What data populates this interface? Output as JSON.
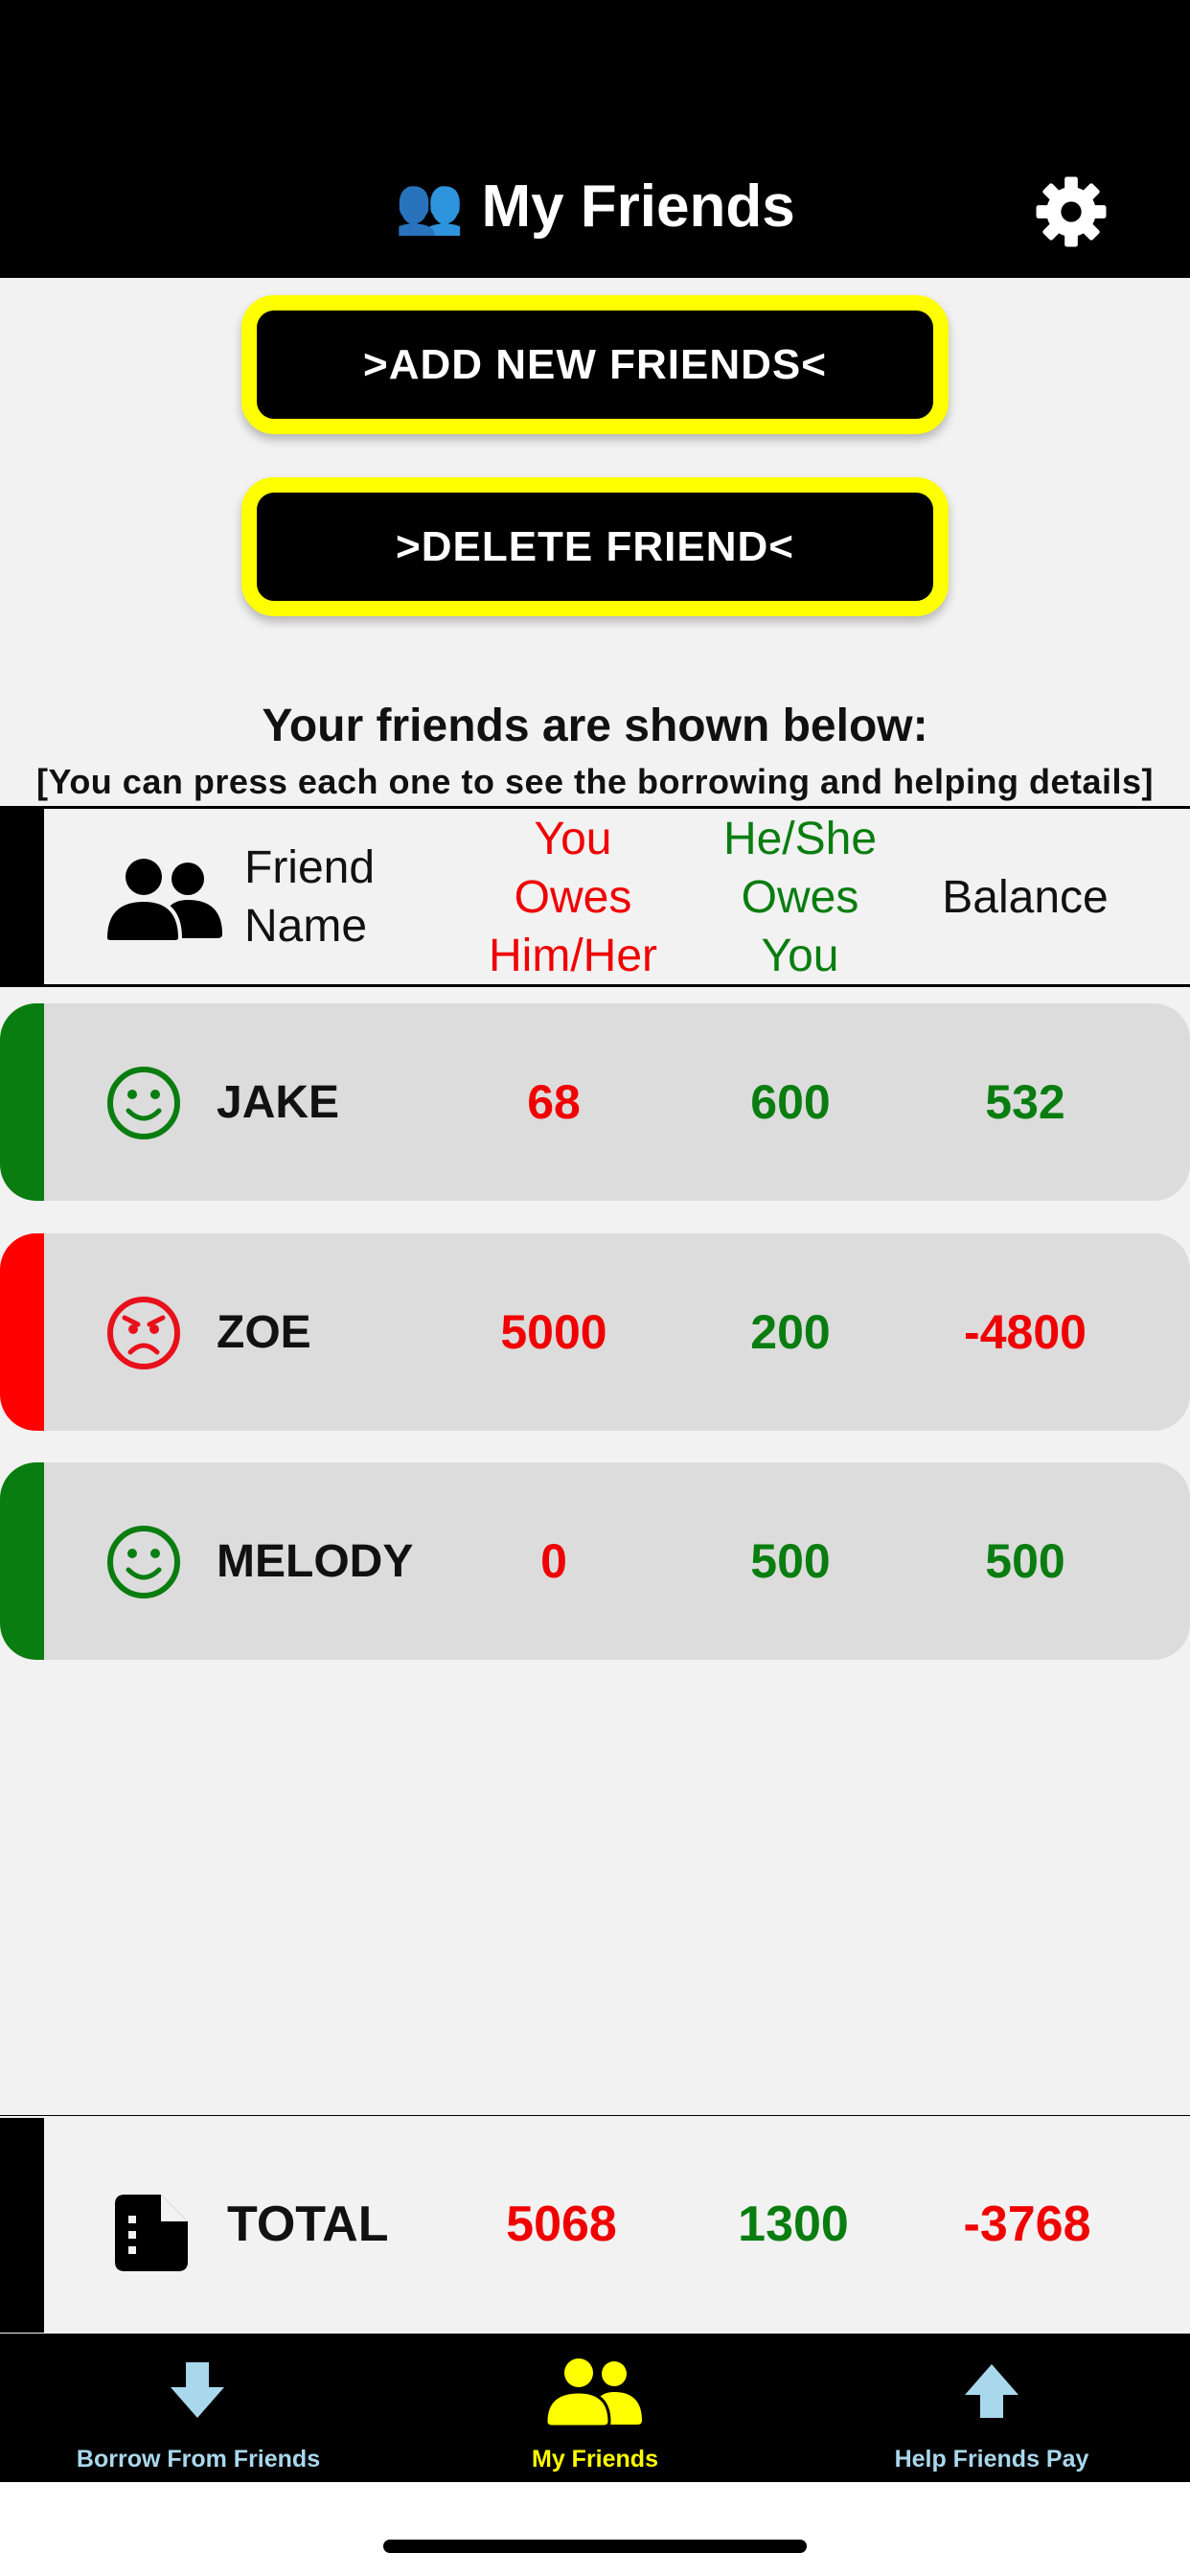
{
  "header": {
    "title": "My Friends",
    "title_emoji": "👥",
    "settings_icon": "gear-icon"
  },
  "actions": {
    "add_label": ">ADD NEW FRIENDS<",
    "delete_label": ">DELETE FRIEND<"
  },
  "intro": {
    "caption": "Your friends are shown below:",
    "hint": "[You can press each one to see the borrowing and helping details]"
  },
  "table_header": {
    "name_line1": "Friend",
    "name_line2": "Name",
    "you_owe_line1": "You",
    "you_owe_line2": "Owes",
    "you_owe_line3": "Him/Her",
    "he_owes_line1": "He/She",
    "he_owes_line2": "Owes",
    "he_owes_line3": "You",
    "balance": "Balance"
  },
  "friends": [
    {
      "name": "JAKE",
      "you_owe": "68",
      "he_owes": "600",
      "balance": "532",
      "status": "positive",
      "face_icon": "smile-face-icon"
    },
    {
      "name": "ZOE",
      "you_owe": "5000",
      "he_owes": "200",
      "balance": "-4800",
      "status": "negative",
      "face_icon": "angry-face-icon"
    },
    {
      "name": "MELODY",
      "you_owe": "0",
      "he_owes": "500",
      "balance": "500",
      "status": "positive",
      "face_icon": "smile-face-icon"
    }
  ],
  "total": {
    "label": "TOTAL",
    "you_owe": "5068",
    "he_owes": "1300",
    "balance": "-3768",
    "icon": "document-icon"
  },
  "tabs": [
    {
      "label": "Borrow From Friends",
      "icon": "arrow-down-icon",
      "active": false
    },
    {
      "label": "My Friends",
      "icon": "people-icon",
      "active": true
    },
    {
      "label": "Help Friends Pay",
      "icon": "arrow-up-icon",
      "active": false
    }
  ],
  "colors": {
    "positive": "#0a7d10",
    "negative": "#f00000",
    "accent_yellow": "#ffff00",
    "tab_inactive": "#a9d8ec",
    "tab_active": "#ffff00"
  }
}
